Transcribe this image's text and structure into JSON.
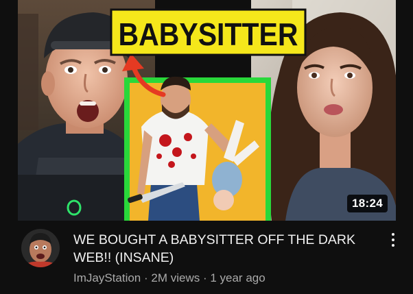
{
  "video": {
    "thumbnail_caption": "BABYSITTER",
    "duration": "18:24",
    "title": "WE BOUGHT A BABYSITTER OFF THE DARK WEB!! (INSANE)",
    "channel": "ImJayStation",
    "views": "2M views",
    "age": "1 year ago",
    "separator": " · "
  },
  "icons": {
    "menu": "more-vert-icon",
    "avatar": "channel-avatar"
  },
  "colors": {
    "caption_bg": "#f5e71b",
    "green_frame": "#29d83a",
    "arrow": "#e53a22",
    "frame_bg": "#f2b52b"
  }
}
